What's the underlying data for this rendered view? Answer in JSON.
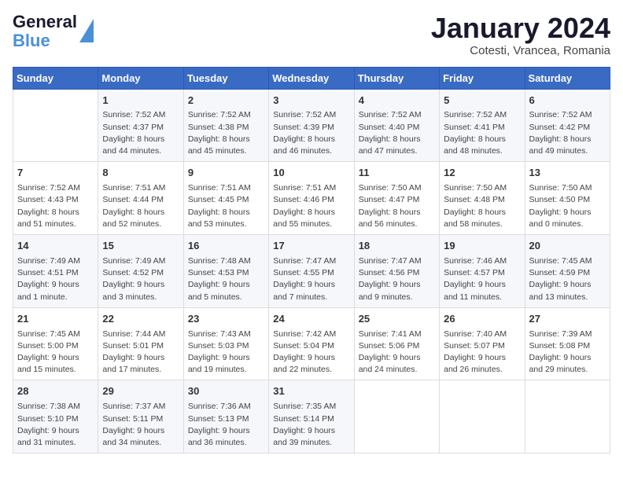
{
  "header": {
    "logo_line1": "General",
    "logo_line2": "Blue",
    "title": "January 2024",
    "subtitle": "Cotesti, Vrancea, Romania"
  },
  "calendar": {
    "days_of_week": [
      "Sunday",
      "Monday",
      "Tuesday",
      "Wednesday",
      "Thursday",
      "Friday",
      "Saturday"
    ],
    "weeks": [
      [
        {
          "day": "",
          "info": ""
        },
        {
          "day": "1",
          "info": "Sunrise: 7:52 AM\nSunset: 4:37 PM\nDaylight: 8 hours\nand 44 minutes."
        },
        {
          "day": "2",
          "info": "Sunrise: 7:52 AM\nSunset: 4:38 PM\nDaylight: 8 hours\nand 45 minutes."
        },
        {
          "day": "3",
          "info": "Sunrise: 7:52 AM\nSunset: 4:39 PM\nDaylight: 8 hours\nand 46 minutes."
        },
        {
          "day": "4",
          "info": "Sunrise: 7:52 AM\nSunset: 4:40 PM\nDaylight: 8 hours\nand 47 minutes."
        },
        {
          "day": "5",
          "info": "Sunrise: 7:52 AM\nSunset: 4:41 PM\nDaylight: 8 hours\nand 48 minutes."
        },
        {
          "day": "6",
          "info": "Sunrise: 7:52 AM\nSunset: 4:42 PM\nDaylight: 8 hours\nand 49 minutes."
        }
      ],
      [
        {
          "day": "7",
          "info": "Sunrise: 7:52 AM\nSunset: 4:43 PM\nDaylight: 8 hours\nand 51 minutes."
        },
        {
          "day": "8",
          "info": "Sunrise: 7:51 AM\nSunset: 4:44 PM\nDaylight: 8 hours\nand 52 minutes."
        },
        {
          "day": "9",
          "info": "Sunrise: 7:51 AM\nSunset: 4:45 PM\nDaylight: 8 hours\nand 53 minutes."
        },
        {
          "day": "10",
          "info": "Sunrise: 7:51 AM\nSunset: 4:46 PM\nDaylight: 8 hours\nand 55 minutes."
        },
        {
          "day": "11",
          "info": "Sunrise: 7:50 AM\nSunset: 4:47 PM\nDaylight: 8 hours\nand 56 minutes."
        },
        {
          "day": "12",
          "info": "Sunrise: 7:50 AM\nSunset: 4:48 PM\nDaylight: 8 hours\nand 58 minutes."
        },
        {
          "day": "13",
          "info": "Sunrise: 7:50 AM\nSunset: 4:50 PM\nDaylight: 9 hours\nand 0 minutes."
        }
      ],
      [
        {
          "day": "14",
          "info": "Sunrise: 7:49 AM\nSunset: 4:51 PM\nDaylight: 9 hours\nand 1 minute."
        },
        {
          "day": "15",
          "info": "Sunrise: 7:49 AM\nSunset: 4:52 PM\nDaylight: 9 hours\nand 3 minutes."
        },
        {
          "day": "16",
          "info": "Sunrise: 7:48 AM\nSunset: 4:53 PM\nDaylight: 9 hours\nand 5 minutes."
        },
        {
          "day": "17",
          "info": "Sunrise: 7:47 AM\nSunset: 4:55 PM\nDaylight: 9 hours\nand 7 minutes."
        },
        {
          "day": "18",
          "info": "Sunrise: 7:47 AM\nSunset: 4:56 PM\nDaylight: 9 hours\nand 9 minutes."
        },
        {
          "day": "19",
          "info": "Sunrise: 7:46 AM\nSunset: 4:57 PM\nDaylight: 9 hours\nand 11 minutes."
        },
        {
          "day": "20",
          "info": "Sunrise: 7:45 AM\nSunset: 4:59 PM\nDaylight: 9 hours\nand 13 minutes."
        }
      ],
      [
        {
          "day": "21",
          "info": "Sunrise: 7:45 AM\nSunset: 5:00 PM\nDaylight: 9 hours\nand 15 minutes."
        },
        {
          "day": "22",
          "info": "Sunrise: 7:44 AM\nSunset: 5:01 PM\nDaylight: 9 hours\nand 17 minutes."
        },
        {
          "day": "23",
          "info": "Sunrise: 7:43 AM\nSunset: 5:03 PM\nDaylight: 9 hours\nand 19 minutes."
        },
        {
          "day": "24",
          "info": "Sunrise: 7:42 AM\nSunset: 5:04 PM\nDaylight: 9 hours\nand 22 minutes."
        },
        {
          "day": "25",
          "info": "Sunrise: 7:41 AM\nSunset: 5:06 PM\nDaylight: 9 hours\nand 24 minutes."
        },
        {
          "day": "26",
          "info": "Sunrise: 7:40 AM\nSunset: 5:07 PM\nDaylight: 9 hours\nand 26 minutes."
        },
        {
          "day": "27",
          "info": "Sunrise: 7:39 AM\nSunset: 5:08 PM\nDaylight: 9 hours\nand 29 minutes."
        }
      ],
      [
        {
          "day": "28",
          "info": "Sunrise: 7:38 AM\nSunset: 5:10 PM\nDaylight: 9 hours\nand 31 minutes."
        },
        {
          "day": "29",
          "info": "Sunrise: 7:37 AM\nSunset: 5:11 PM\nDaylight: 9 hours\nand 34 minutes."
        },
        {
          "day": "30",
          "info": "Sunrise: 7:36 AM\nSunset: 5:13 PM\nDaylight: 9 hours\nand 36 minutes."
        },
        {
          "day": "31",
          "info": "Sunrise: 7:35 AM\nSunset: 5:14 PM\nDaylight: 9 hours\nand 39 minutes."
        },
        {
          "day": "",
          "info": ""
        },
        {
          "day": "",
          "info": ""
        },
        {
          "day": "",
          "info": ""
        }
      ]
    ]
  }
}
